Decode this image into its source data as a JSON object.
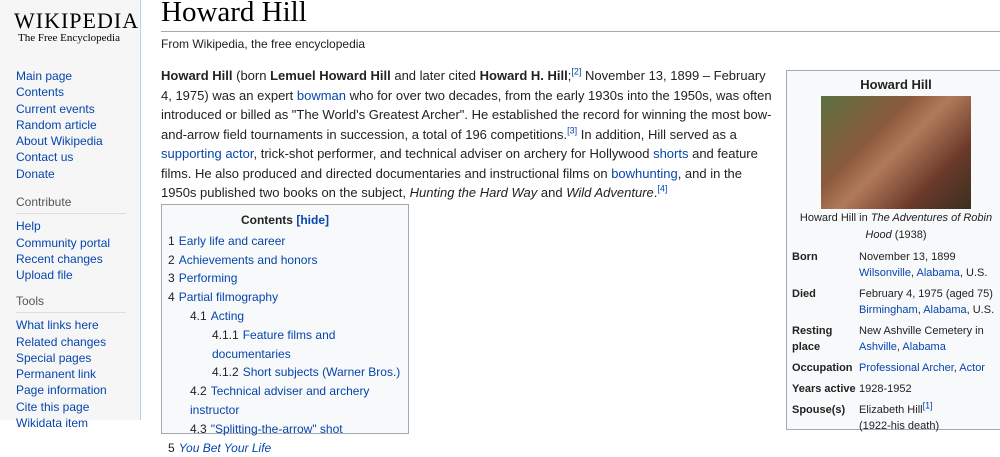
{
  "logo": {
    "name": "Wikipedia",
    "tagline": "The Free Encyclopedia"
  },
  "sidebar": {
    "nav": [
      "Main page",
      "Contents",
      "Current events",
      "Random article",
      "About Wikipedia",
      "Contact us",
      "Donate"
    ],
    "contribute_heading": "Contribute",
    "contribute": [
      "Help",
      "Community portal",
      "Recent changes",
      "Upload file"
    ],
    "tools_heading": "Tools",
    "tools": [
      "What links here",
      "Related changes",
      "Special pages",
      "Permanent link",
      "Page information",
      "Cite this page",
      "Wikidata item"
    ]
  },
  "article": {
    "title": "Howard Hill",
    "subtitle": "From Wikipedia, the free encyclopedia",
    "lead": {
      "b1": "Howard Hill",
      "t1": " (born ",
      "b2": "Lemuel Howard Hill",
      "t2": " and later cited ",
      "b3": "Howard H. Hill",
      "t3": ";",
      "r2": "[2]",
      "t4": " November 13, 1899 – February 4, 1975) was an expert ",
      "l1": "bowman",
      "t5": " who for over two decades, from the early 1930s into the 1950s, was often introduced or billed as \"The World's Greatest Archer\". He established the record for winning the most bow-and-arrow field tournaments in succession, a total of 196 competitions.",
      "r3": "[3]",
      "t6": " In addition, Hill served as a ",
      "l2": "supporting actor",
      "t7": ", trick-shot performer, and technical adviser on archery for Hollywood ",
      "l3": "shorts",
      "t8": " and feature films. He also produced and directed documentaries and instructional films on ",
      "l4": "bowhunting",
      "t9": ", and in the 1950s published two books on the subject, ",
      "i1": "Hunting the Hard Way",
      "t10": " and ",
      "i2": "Wild Adventure",
      "t11": ".",
      "r4": "[4]"
    }
  },
  "toc": {
    "title": "Contents",
    "hide": "[hide]",
    "items": [
      {
        "num": "1",
        "label": "Early life and career",
        "level": 1
      },
      {
        "num": "2",
        "label": "Achievements and honors",
        "level": 1
      },
      {
        "num": "3",
        "label": "Performing",
        "level": 1
      },
      {
        "num": "4",
        "label": "Partial filmography",
        "level": 1
      },
      {
        "num": "4.1",
        "label": "Acting",
        "level": 2
      },
      {
        "num": "4.1.1",
        "label": "Feature films and documentaries",
        "level": 3
      },
      {
        "num": "4.1.2",
        "label": "Short subjects (Warner Bros.)",
        "level": 3
      },
      {
        "num": "4.2",
        "label": "Technical adviser and archery instructor",
        "level": 2
      },
      {
        "num": "4.3",
        "label": "\"Splitting-the-arrow\" shot",
        "level": 2
      },
      {
        "num": "5",
        "label": "You Bet Your Life",
        "level": 1
      }
    ]
  },
  "infobox": {
    "title": "Howard Hill",
    "caption": {
      "a": "Howard Hill in ",
      "i": "The Adventures of Robin Hood",
      "b": " (1938)"
    },
    "born": {
      "label": "Born",
      "date": "November 13, 1899",
      "l1": "Wilsonville",
      "l2": "Alabama",
      "tail": ", U.S."
    },
    "died": {
      "label": "Died",
      "date": "February 4, 1975 (aged 75)",
      "l1": "Birmingham",
      "l2": "Alabama",
      "tail": ", U.S."
    },
    "resting": {
      "label": "Resting place",
      "text": "New Ashville Cemetery in",
      "l1": "Ashville",
      "l2": "Alabama"
    },
    "occupation": {
      "label": "Occupation",
      "l1": "Professional Archer",
      "l2": "Actor"
    },
    "years": {
      "label": "Years active",
      "value": "1928-1952"
    },
    "spouse": {
      "label": "Spouse(s)",
      "name": "Elizabeth Hill",
      "ref": "[1]",
      "years": "(1922-his death)"
    }
  }
}
